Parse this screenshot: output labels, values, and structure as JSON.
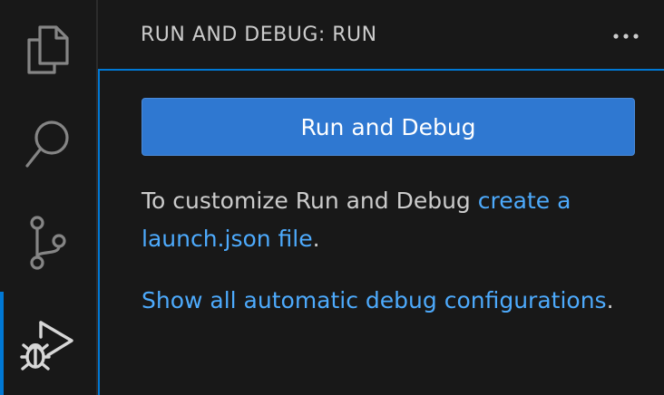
{
  "activity_bar": {
    "items": [
      {
        "name": "explorer",
        "icon": "files-icon",
        "active": false
      },
      {
        "name": "search",
        "icon": "search-icon",
        "active": false
      },
      {
        "name": "source-control",
        "icon": "source-control-icon",
        "active": false
      },
      {
        "name": "run-and-debug",
        "icon": "run-debug-icon",
        "active": true
      }
    ],
    "icon_color": "#858585",
    "active_icon_color": "#d7d7d7",
    "active_indicator_color": "#0078d4"
  },
  "sidebar": {
    "title": "RUN AND DEBUG: RUN",
    "more_actions_icon": "ellipsis-icon"
  },
  "view": {
    "run_button_label": "Run and Debug",
    "customize_text": "To customize Run and Debug ",
    "create_link": "create a launch.json file",
    "customize_suffix": ".",
    "show_all_link": "Show all automatic debug configurations",
    "show_all_suffix": "."
  },
  "colors": {
    "background": "#181818",
    "button": "#2f78d1",
    "link": "#4daafc",
    "text": "#cccccc",
    "focus_border": "#0078d4"
  }
}
